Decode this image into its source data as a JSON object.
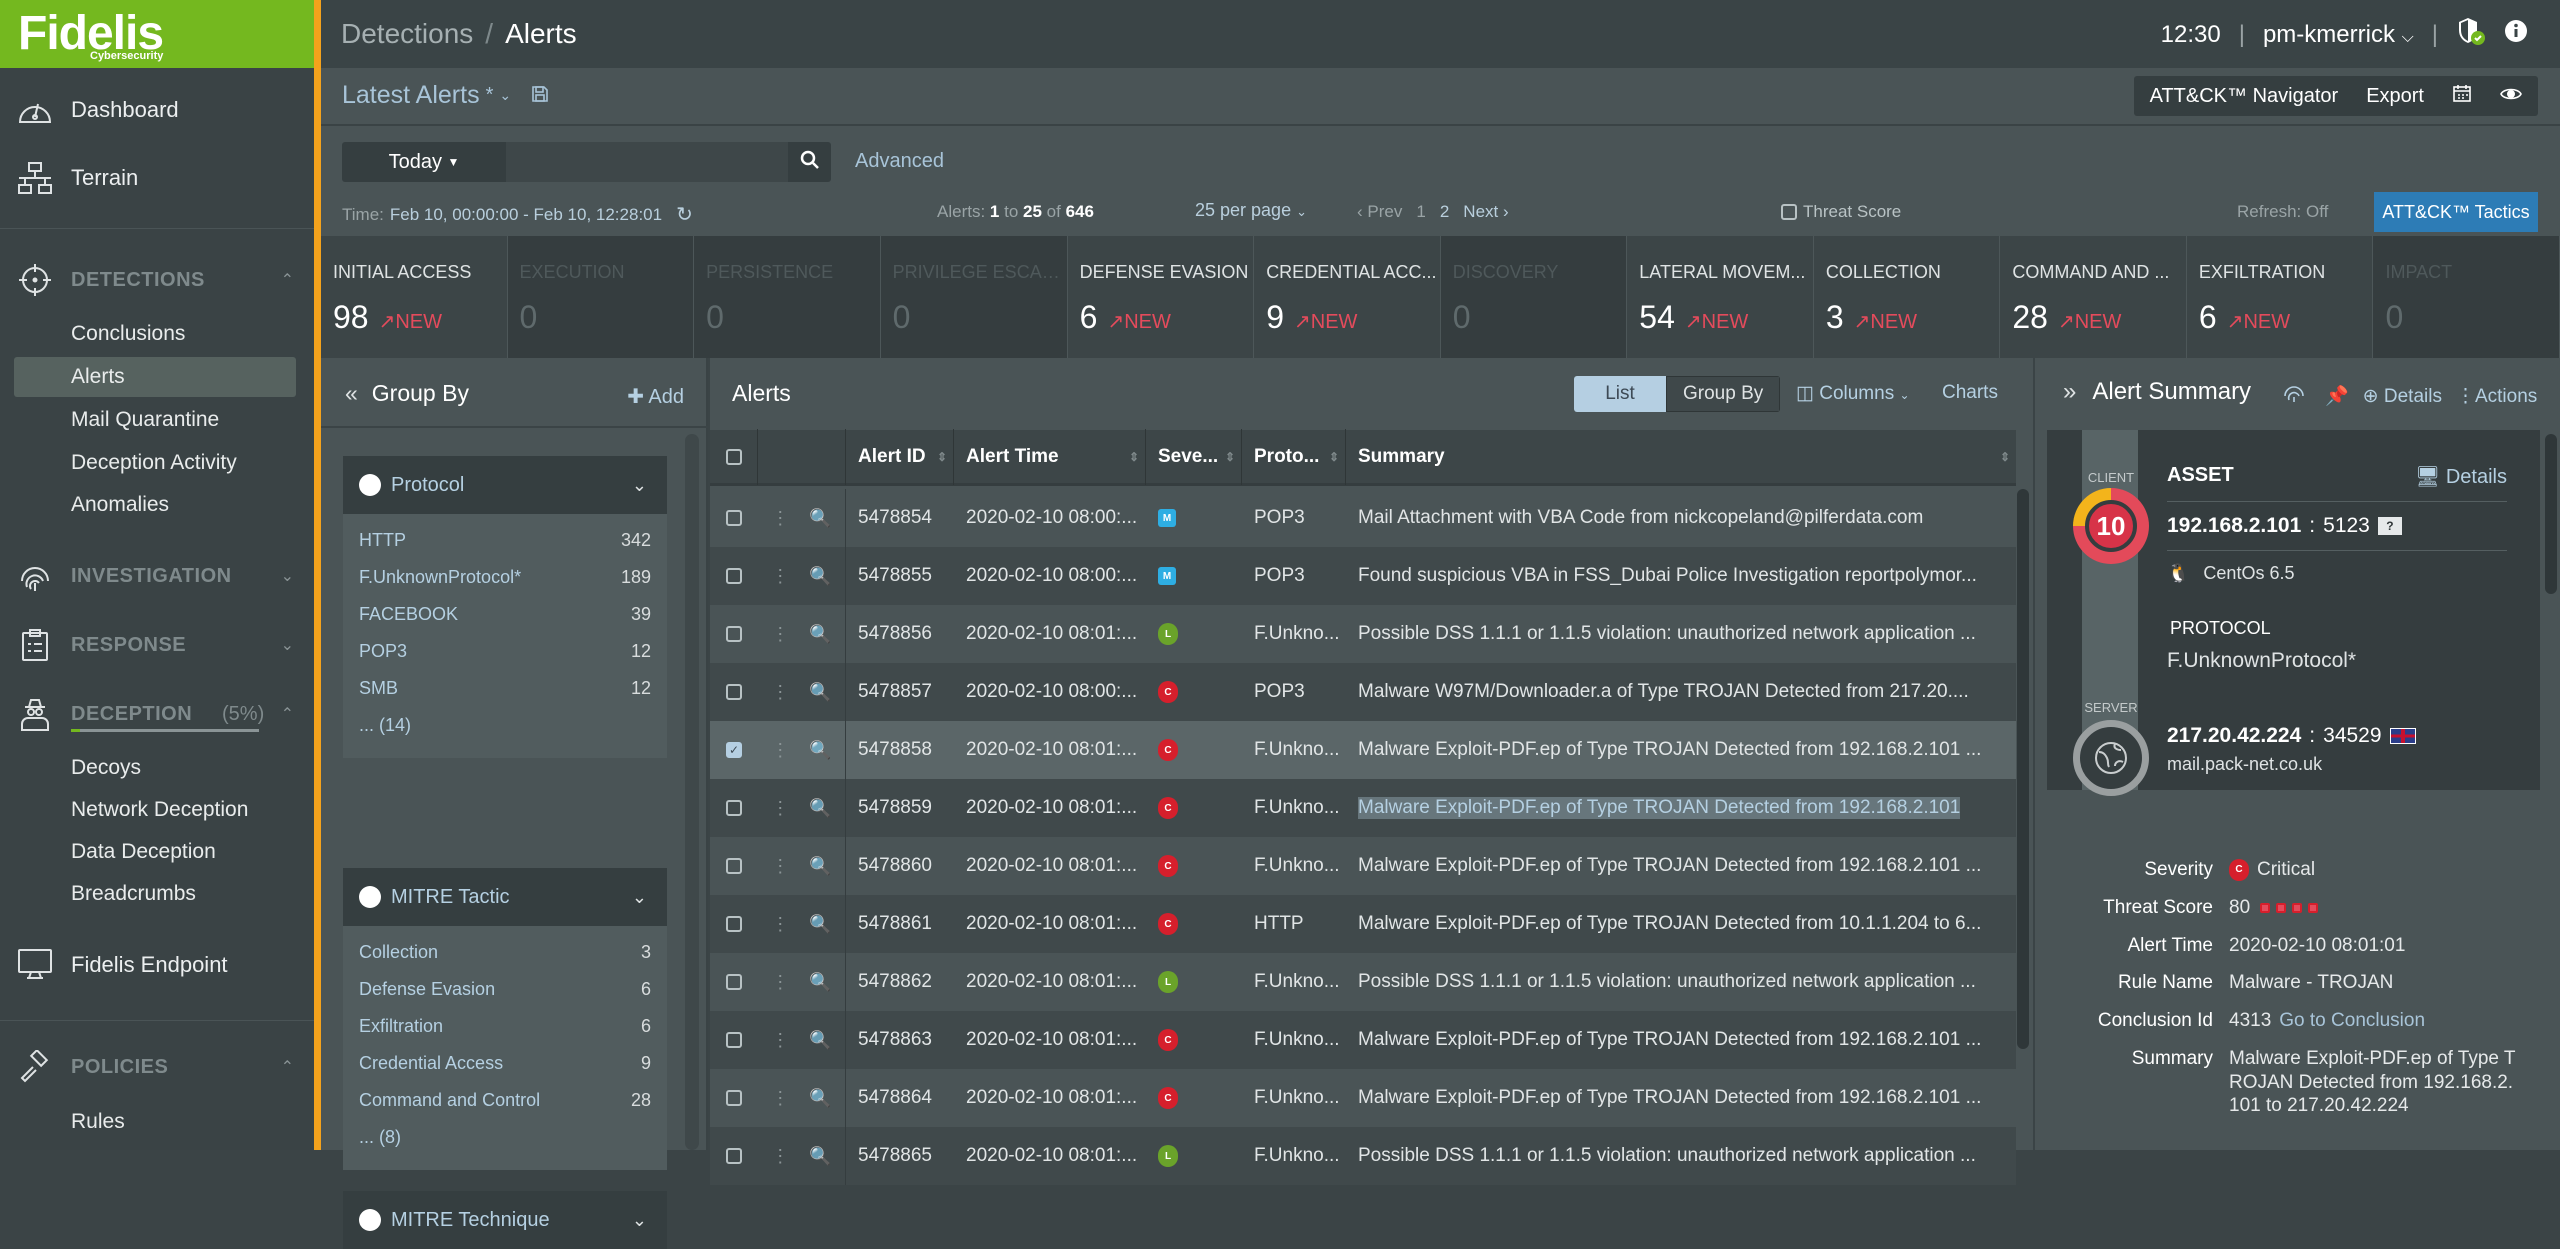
{
  "sidebar": {
    "logo": {
      "word": "Fidelis",
      "sub": "Cybersecurity",
      "brand_color": "#74b81f"
    },
    "top_items": [
      {
        "label": "Dashboard",
        "icon": "dashboard-gauge-icon"
      },
      {
        "label": "Terrain",
        "icon": "network-topology-icon"
      }
    ],
    "sections": [
      {
        "label": "DETECTIONS",
        "icon": "crosshair-icon",
        "expanded": true,
        "items": [
          "Conclusions",
          "Alerts",
          "Mail Quarantine",
          "Deception Activity",
          "Anomalies"
        ],
        "active": "Alerts"
      },
      {
        "label": "INVESTIGATION",
        "icon": "fingerprint-icon",
        "expanded": false,
        "items": []
      },
      {
        "label": "RESPONSE",
        "icon": "clipboard-icon",
        "expanded": false,
        "items": []
      },
      {
        "label": "DECEPTION",
        "icon": "spy-icon",
        "expanded": true,
        "progress_label": "(5%)",
        "progress": 0.05,
        "items": [
          "Decoys",
          "Network Deception",
          "Data Deception",
          "Breadcrumbs"
        ]
      },
      {
        "label": "POLICIES",
        "icon": "gavel-icon",
        "expanded": true,
        "items": [
          "Rules"
        ]
      }
    ],
    "endpoint": {
      "label": "Fidelis Endpoint",
      "icon": "monitor-icon"
    }
  },
  "header": {
    "breadcrumb": [
      "Detections",
      "Alerts"
    ],
    "separator": "/",
    "clock": "12:30",
    "user": "pm-kmerrick",
    "accent": "#f4a21c"
  },
  "subheader": {
    "view_name": "Latest Alerts",
    "modified_marker": "*",
    "buttons": [
      "ATT&CK™ Navigator",
      "Export"
    ]
  },
  "filters": {
    "time_range": "Today",
    "search_value": "",
    "search_placeholder": "",
    "advanced": "Advanced",
    "time_label": "Time:",
    "time_value": "Feb 10, 00:00:00 - Feb 10, 12:28:01",
    "alerts_label": "Alerts:",
    "range_from": "1",
    "range_to": "25",
    "total": "646",
    "per_page": "25 per page",
    "prev": "Prev",
    "pages": [
      "1",
      "2"
    ],
    "next": "Next",
    "threat_score_label": "Threat Score",
    "threat_score_checked": false,
    "refresh_label": "Refresh:",
    "refresh_value": "Off",
    "tactics_button": "ATT&CK™ Tactics",
    "tactics_button_color": "#2d7cb6"
  },
  "tactics": [
    {
      "name": "INITIAL ACCESS",
      "count": "98",
      "new": "NEW",
      "active": true
    },
    {
      "name": "EXECUTION",
      "count": "0",
      "new": "",
      "active": false
    },
    {
      "name": "PERSISTENCE",
      "count": "0",
      "new": "",
      "active": false
    },
    {
      "name": "PRIVILEGE ESCAL...",
      "count": "0",
      "new": "",
      "active": false
    },
    {
      "name": "DEFENSE EVASION",
      "count": "6",
      "new": "NEW",
      "active": true
    },
    {
      "name": "CREDENTIAL ACC...",
      "count": "9",
      "new": "NEW",
      "active": true
    },
    {
      "name": "DISCOVERY",
      "count": "0",
      "new": "",
      "active": false
    },
    {
      "name": "LATERAL MOVEM...",
      "count": "54",
      "new": "NEW",
      "active": true
    },
    {
      "name": "COLLECTION",
      "count": "3",
      "new": "NEW",
      "active": true
    },
    {
      "name": "COMMAND AND ...",
      "count": "28",
      "new": "NEW",
      "active": true
    },
    {
      "name": "EXFILTRATION",
      "count": "6",
      "new": "NEW",
      "active": true
    },
    {
      "name": "IMPACT",
      "count": "0",
      "new": "",
      "active": false
    }
  ],
  "group_by": {
    "title": "Group By",
    "add": "Add",
    "facets": [
      {
        "name": "Protocol",
        "items": [
          {
            "label": "HTTP",
            "count": "342"
          },
          {
            "label": "F.UnknownProtocol*",
            "count": "189"
          },
          {
            "label": "FACEBOOK",
            "count": "39"
          },
          {
            "label": "POP3",
            "count": "12"
          },
          {
            "label": "SMB",
            "count": "12"
          }
        ],
        "more": "... (14)"
      },
      {
        "name": "MITRE Tactic",
        "items": [
          {
            "label": "Collection",
            "count": "3"
          },
          {
            "label": "Defense Evasion",
            "count": "6"
          },
          {
            "label": "Exfiltration",
            "count": "6"
          },
          {
            "label": "Credential Access",
            "count": "9"
          },
          {
            "label": "Command and Control",
            "count": "28"
          }
        ],
        "more": "... (8)"
      },
      {
        "name": "MITRE Technique",
        "items": [],
        "more": ""
      }
    ]
  },
  "alerts": {
    "title": "Alerts",
    "view_list": "List",
    "view_group": "Group By",
    "columns": "Columns",
    "charts": "Charts",
    "headers": [
      "Alert ID",
      "Alert Time",
      "Seve...",
      "Proto...",
      "Summary"
    ],
    "rows": [
      {
        "id": "5478854",
        "time": "2020-02-10 08:00:...",
        "sev": "M",
        "proto": "POP3",
        "summary": "Mail Attachment with VBA Code from nickcopeland@pilferdata.com",
        "checked": false
      },
      {
        "id": "5478855",
        "time": "2020-02-10 08:00:...",
        "sev": "M",
        "proto": "POP3",
        "summary": "Found suspicious VBA in FSS_Dubai Police Investigation reportpolymor...",
        "checked": false
      },
      {
        "id": "5478856",
        "time": "2020-02-10 08:01:...",
        "sev": "L",
        "proto": "F.Unkno...",
        "summary": "Possible DSS 1.1.1 or 1.1.5 violation: unauthorized network application ...",
        "checked": false
      },
      {
        "id": "5478857",
        "time": "2020-02-10 08:00:...",
        "sev": "C",
        "proto": "POP3",
        "summary": "Malware W97M/Downloader.a of Type TROJAN Detected from 217.20....",
        "checked": false
      },
      {
        "id": "5478858",
        "time": "2020-02-10 08:01:...",
        "sev": "C",
        "proto": "F.Unkno...",
        "summary": "Malware Exploit-PDF.ep of Type TROJAN Detected from 192.168.2.101 ...",
        "checked": true
      },
      {
        "id": "5478859",
        "time": "2020-02-10 08:01:...",
        "sev": "C",
        "proto": "F.Unkno...",
        "summary": "Malware Exploit-PDF.ep of Type TROJAN Detected from 192.168.2.101",
        "checked": false,
        "highlight": true
      },
      {
        "id": "5478860",
        "time": "2020-02-10 08:01:...",
        "sev": "C",
        "proto": "F.Unkno...",
        "summary": "Malware Exploit-PDF.ep of Type TROJAN Detected from 192.168.2.101 ...",
        "checked": false
      },
      {
        "id": "5478861",
        "time": "2020-02-10 08:01:...",
        "sev": "C",
        "proto": "HTTP",
        "summary": "Malware Exploit-PDF.ep of Type TROJAN Detected from 10.1.1.204 to 6...",
        "checked": false
      },
      {
        "id": "5478862",
        "time": "2020-02-10 08:01:...",
        "sev": "L",
        "proto": "F.Unkno...",
        "summary": "Possible DSS 1.1.1 or 1.1.5 violation: unauthorized network application ...",
        "checked": false
      },
      {
        "id": "5478863",
        "time": "2020-02-10 08:01:...",
        "sev": "C",
        "proto": "F.Unkno...",
        "summary": "Malware Exploit-PDF.ep of Type TROJAN Detected from 192.168.2.101 ...",
        "checked": false
      },
      {
        "id": "5478864",
        "time": "2020-02-10 08:01:...",
        "sev": "C",
        "proto": "F.Unkno...",
        "summary": "Malware Exploit-PDF.ep of Type TROJAN Detected from 192.168.2.101 ...",
        "checked": false
      },
      {
        "id": "5478865",
        "time": "2020-02-10 08:01:...",
        "sev": "L",
        "proto": "F.Unkno...",
        "summary": "Possible DSS 1.1.1 or 1.1.5 violation: unauthorized network application ...",
        "checked": false
      }
    ],
    "severity_colors": {
      "C": "#d61f2c",
      "M": "#2eaee3",
      "L": "#6aa32a"
    }
  },
  "summary": {
    "title": "Alert Summary",
    "details": "Details",
    "actions": "Actions",
    "client_label": "CLIENT",
    "server_label": "SERVER",
    "score": "10",
    "asset_label": "ASSET",
    "asset_details": "Details",
    "client_ip": "192.168.2.101",
    "client_port": "5123",
    "client_country": "?",
    "os": "CentOs 6.5",
    "protocol_label": "PROTOCOL",
    "protocol": "F.UnknownProtocol*",
    "server_ip": "217.20.42.224",
    "server_port": "34529",
    "server_host": "mail.pack-net.co.uk",
    "fields": {
      "severity_label": "Severity",
      "severity": "Critical",
      "severity_badge": "C",
      "threat_label": "Threat Score",
      "threat": "80",
      "threat_level": 4,
      "time_label": "Alert Time",
      "time": "2020-02-10 08:01:01",
      "rule_label": "Rule Name",
      "rule": "Malware - TROJAN",
      "conclusion_label": "Conclusion Id",
      "conclusion": "4313",
      "conclusion_link": "Go to Conclusion",
      "summary_label": "Summary",
      "summary": "Malware Exploit-PDF.ep of Type TROJAN Detected from 192.168.2.101 to 217.20.42.224"
    }
  }
}
